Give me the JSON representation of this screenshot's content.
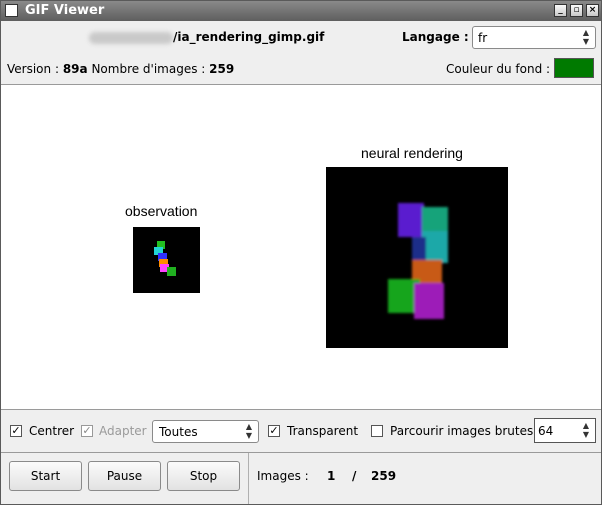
{
  "window": {
    "title": "GIF Viewer",
    "controls": [
      "_",
      "▫",
      "×"
    ]
  },
  "header": {
    "filename": "/ia_rendering_gimp.gif",
    "language_label": "Langage :",
    "language_value": "fr",
    "version_label": "Version :",
    "version_value": "89a",
    "frames_label": "Nombre d'images :",
    "frames_value": "259",
    "bg_label": "Couleur du fond :",
    "bg_color": "#007a00"
  },
  "canvas": {
    "left_label": "observation",
    "right_label": "neural rendering"
  },
  "options": {
    "center_label": "Centrer",
    "center_checked": true,
    "fit_label": "Adapter",
    "fit_checked": true,
    "filter_value": "Toutes",
    "transparent_label": "Transparent",
    "transparent_checked": true,
    "raw_label": "Parcourir images brutes",
    "raw_checked": false,
    "spin_value": "64"
  },
  "controls": {
    "start": "Start",
    "pause": "Pause",
    "stop": "Stop",
    "images_label": "Images :",
    "current": "1",
    "slash": "/",
    "total": "259"
  }
}
